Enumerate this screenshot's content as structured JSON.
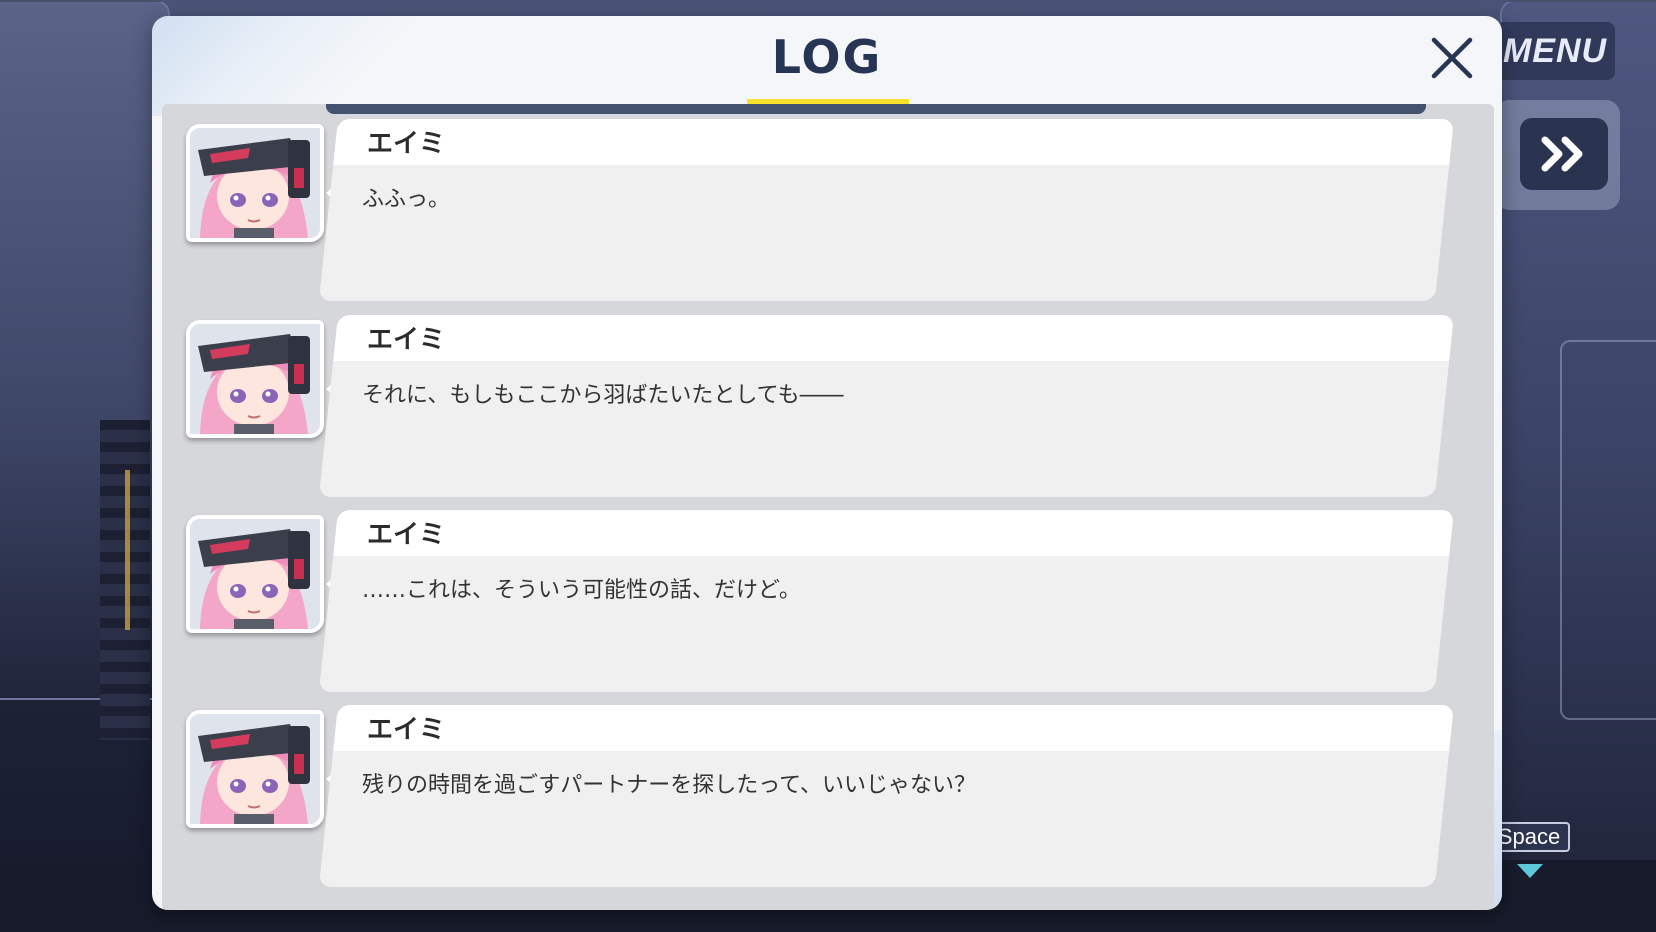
{
  "hud": {
    "menu_label": "MENU",
    "skip_icon": "fast-forward-icon",
    "space_hint": "Space"
  },
  "log": {
    "title": "LOG",
    "close_icon": "close-icon",
    "accent_color": "#f7e02a",
    "title_color": "#263553",
    "entries": [
      {
        "speaker": "エイミ",
        "text": "ふふっ。"
      },
      {
        "speaker": "エイミ",
        "text": "それに、もしもここから羽ばたいたとしても――"
      },
      {
        "speaker": "エイミ",
        "text": "……これは、そういう可能性の話、だけど。"
      },
      {
        "speaker": "エイミ",
        "text": "残りの時間を過ごすパートナーを探したって、いいじゃない？"
      }
    ]
  }
}
